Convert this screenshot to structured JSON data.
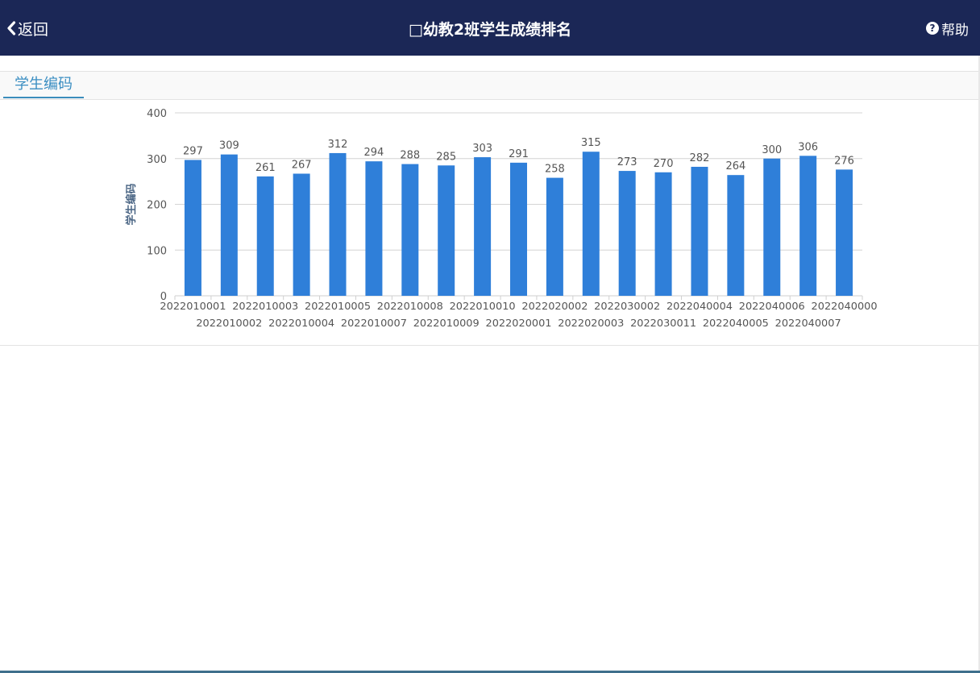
{
  "header": {
    "back_label": "返回",
    "title": "□幼教2班学生成绩排名",
    "help_label": "帮助"
  },
  "tabs": [
    {
      "label": "学生编码",
      "active": true
    }
  ],
  "colors": {
    "header_bg": "#1b2756",
    "bar": "#2f7fd9",
    "tab_active": "#3a8ec2"
  },
  "chart_data": {
    "type": "bar",
    "ylabel": "学生编码",
    "ylim": [
      0,
      400
    ],
    "yticks": [
      0,
      100,
      200,
      300,
      400
    ],
    "grid": true,
    "categories": [
      "2022010001",
      "2022010002",
      "2022010003",
      "2022010004",
      "2022010005",
      "2022010007",
      "2022010008",
      "2022010009",
      "2022010010",
      "2022020001",
      "2022020002",
      "2022020003",
      "2022030002",
      "2022030011",
      "2022040004",
      "2022040005",
      "2022040006",
      "2022040007",
      "2022040000"
    ],
    "values": [
      297,
      309,
      261,
      267,
      312,
      294,
      288,
      285,
      303,
      291,
      258,
      315,
      273,
      270,
      282,
      264,
      300,
      306,
      276
    ]
  }
}
